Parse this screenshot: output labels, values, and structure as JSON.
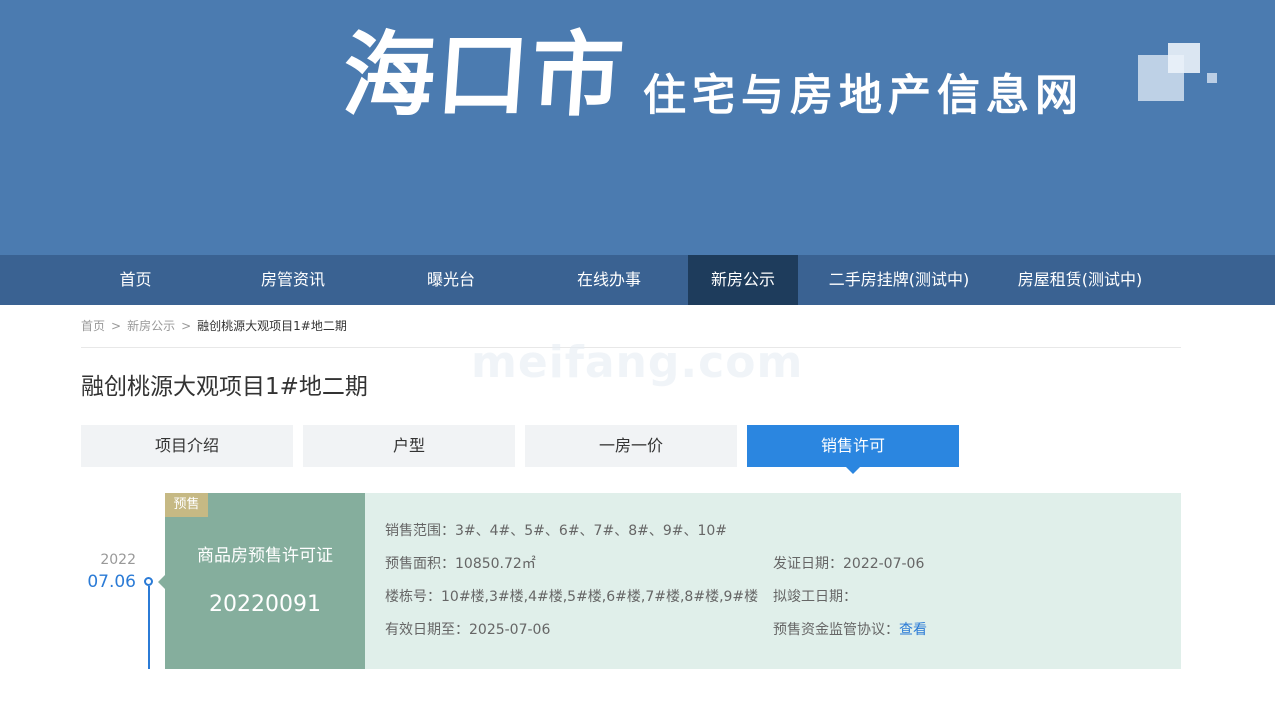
{
  "banner": {
    "city": "海口市",
    "subtitle": "住宅与房地产信息网"
  },
  "nav": {
    "items": [
      {
        "label": "首页",
        "active": false
      },
      {
        "label": "房管资讯",
        "active": false
      },
      {
        "label": "曝光台",
        "active": false
      },
      {
        "label": "在线办事",
        "active": false
      },
      {
        "label": "新房公示",
        "active": true
      },
      {
        "label": "二手房挂牌(测试中)",
        "active": false
      },
      {
        "label": "房屋租赁(测试中)",
        "active": false
      }
    ]
  },
  "breadcrumb": {
    "home": "首页",
    "section": "新房公示",
    "current": "融创桃源大观项目1#地二期",
    "separator": ">"
  },
  "watermark": "meifang.com",
  "project": {
    "title": "融创桃源大观项目1#地二期"
  },
  "tabs": [
    {
      "label": "项目介绍",
      "active": false
    },
    {
      "label": "户型",
      "active": false
    },
    {
      "label": "一房一价",
      "active": false
    },
    {
      "label": "销售许可",
      "active": true
    }
  ],
  "permit": {
    "year": "2022",
    "date": "07.06",
    "badge": "预售",
    "type": "商品房预售许可证",
    "number": "20220091",
    "sale_range_label": "销售范围：",
    "sale_range": "3#、4#、5#、6#、7#、8#、9#、10#",
    "area_label": "预售面积：",
    "area": "10850.72㎡",
    "issue_date_label": "发证日期：",
    "issue_date": "2022-07-06",
    "building_label": "楼栋号：",
    "building": "10#楼,3#楼,4#楼,5#楼,6#楼,7#楼,8#楼,9#楼",
    "completion_label": "拟竣工日期：",
    "completion": "",
    "valid_label": "有效日期至：",
    "valid": "2025-07-06",
    "fund_label": "预售资金监管协议：",
    "fund_link": "查看"
  },
  "colors": {
    "banner_bg": "#4b7bb0",
    "nav_bg": "#3a6292",
    "nav_active": "#1e3c5c",
    "accent_blue": "#2b86e0",
    "card_green": "#85ae9d",
    "card_light": "#e0efea",
    "badge_gold": "#c6b984"
  }
}
